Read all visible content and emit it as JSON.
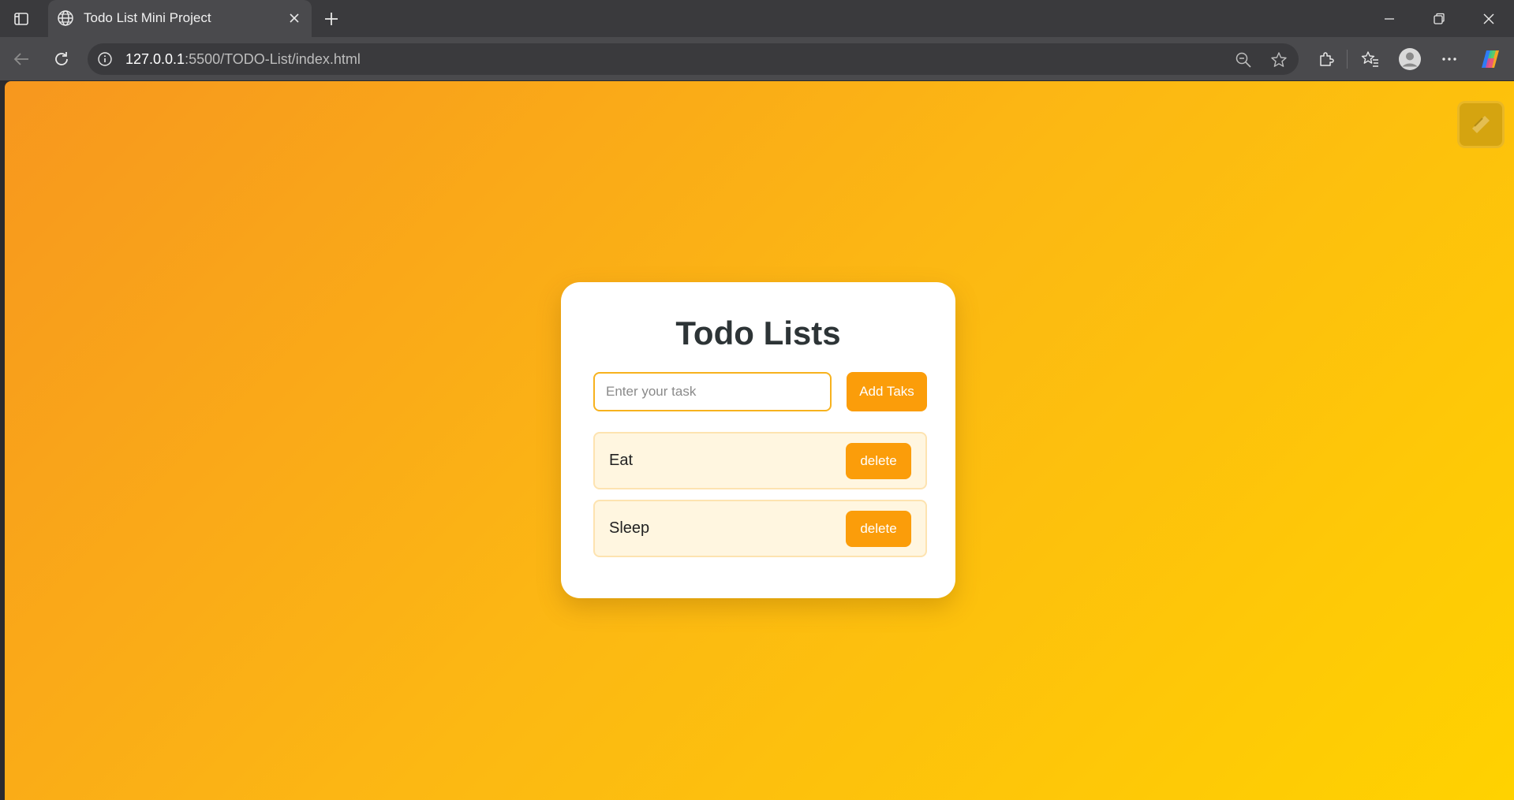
{
  "browser": {
    "tab": {
      "title": "Todo List Mini Project"
    },
    "address": {
      "host": "127.0.0.1",
      "rest": ":5500/TODO-List/index.html"
    },
    "icons": {
      "tab_strip": "tab-strip-icon",
      "favicon": "globe-icon",
      "tab_close": "close-icon",
      "new_tab": "plus-icon",
      "minimize": "minimize-icon",
      "restore": "restore-icon",
      "close_window": "close-icon",
      "back": "back-arrow-icon",
      "reload": "reload-icon",
      "site_info": "info-icon",
      "zoom": "zoom-out-icon",
      "favorite": "star-icon",
      "extensions": "puzzle-icon",
      "favorites": "favorites-icon",
      "profile": "avatar-icon",
      "menu": "more-icon",
      "copilot": "copilot-icon"
    }
  },
  "app": {
    "title": "Todo Lists",
    "input": {
      "placeholder": "Enter your task",
      "value": ""
    },
    "add_button_label": "Add Taks",
    "tasks": [
      {
        "text": "Eat",
        "delete_label": "delete"
      },
      {
        "text": "Sleep",
        "delete_label": "delete"
      }
    ]
  },
  "colors": {
    "accent": "#fb9d0a",
    "gradient_start": "#f7971e",
    "gradient_end": "#ffd200",
    "task_bg": "#fff6e0",
    "title_text": "#2d3436"
  }
}
